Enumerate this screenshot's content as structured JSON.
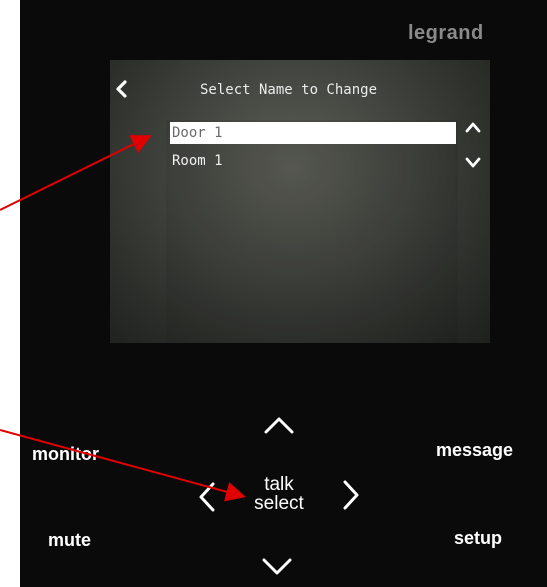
{
  "device": {
    "brand": "legrand"
  },
  "screen": {
    "title": "Select Name to Change",
    "items": [
      {
        "label": "Door 1",
        "selected": true
      },
      {
        "label": "Room 1",
        "selected": false
      }
    ]
  },
  "buttons": {
    "monitor": "monitor",
    "message": "message",
    "mute": "mute",
    "setup": "setup",
    "center_line1": "talk",
    "center_line2": "select"
  },
  "icons": {
    "back": "chevron-left-icon",
    "scroll_up": "chevron-up-icon",
    "scroll_down": "chevron-down-icon",
    "nav_up": "chevron-up-icon",
    "nav_down": "chevron-down-icon",
    "nav_left": "chevron-left-icon",
    "nav_right": "chevron-right-icon"
  },
  "colors": {
    "device_body": "#0a0a0a",
    "selection_bg": "#ffffff",
    "annotation_arrow": "#e00000"
  }
}
